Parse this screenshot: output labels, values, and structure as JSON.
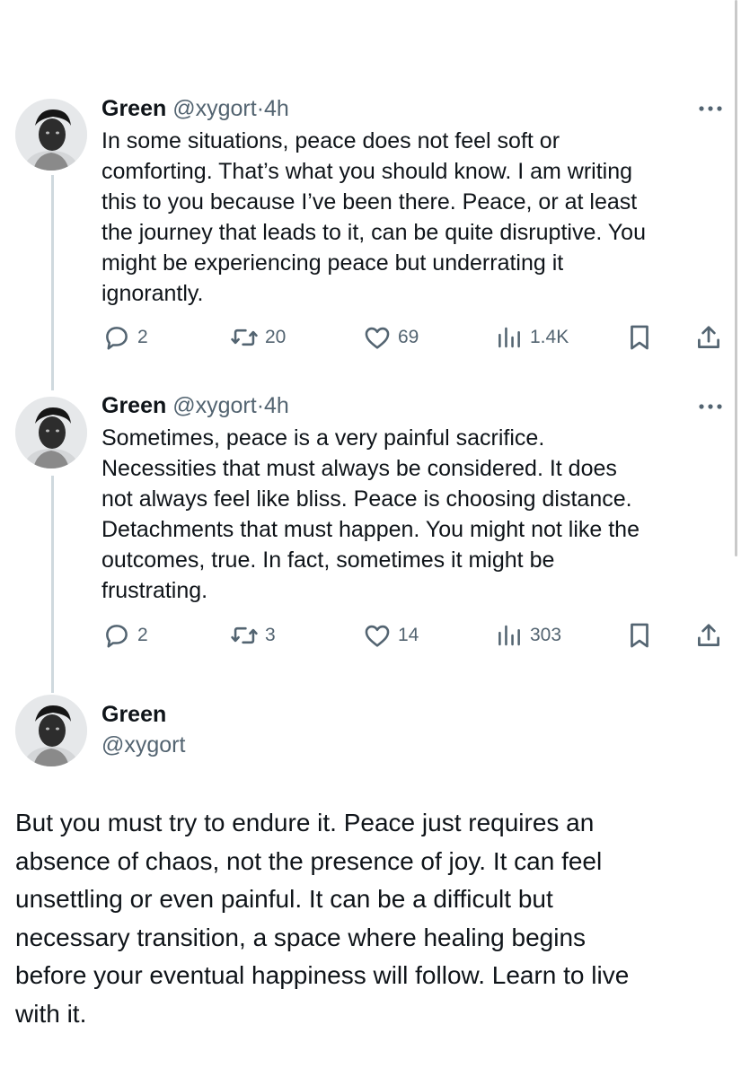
{
  "thread": [
    {
      "author": {
        "name": "Green",
        "handle": "@xygort"
      },
      "separator": "·",
      "time": "4h",
      "lines": [
        "In some situations, peace does not feel soft or",
        "comforting. That’s what you should know. I am writing",
        "this to you because I’ve been there. Peace, or at least",
        "the journey that leads to it, can be quite disruptive. You",
        "might be experiencing peace but underrating it",
        "ignorantly."
      ],
      "stats": {
        "replies": "2",
        "reposts": "20",
        "likes": "69",
        "views": "1.4K"
      }
    },
    {
      "author": {
        "name": "Green",
        "handle": "@xygort"
      },
      "separator": "·",
      "time": "4h",
      "lines": [
        "Sometimes, peace is a very painful sacrifice.",
        "Necessities that must always be considered. It does",
        "not always feel like bliss. Peace is choosing distance.",
        "Detachments that must happen. You might not like the",
        "outcomes, true. In fact, sometimes it might be",
        "frustrating."
      ],
      "stats": {
        "replies": "2",
        "reposts": "3",
        "likes": "14",
        "views": "303"
      }
    }
  ],
  "main_tweet": {
    "author": {
      "name": "Green",
      "handle": "@xygort"
    },
    "lines": [
      "But you must try to endure it. Peace just requires an",
      "absence of chaos, not the presence of joy. It can feel",
      "unsettling or even painful. It can be a difficult but",
      "necessary transition, a space where healing begins",
      "before your eventual happiness will follow. Learn to live",
      "with it."
    ]
  },
  "icons": {
    "more": "more-horizontal-icon",
    "reply": "reply-icon",
    "repost": "repost-icon",
    "like": "like-icon",
    "views": "views-icon",
    "bookmark": "bookmark-icon",
    "share": "share-icon"
  },
  "colors": {
    "text": "#0f1419",
    "secondary": "#536471",
    "thread_line": "#cfd9de",
    "background": "#ffffff"
  }
}
